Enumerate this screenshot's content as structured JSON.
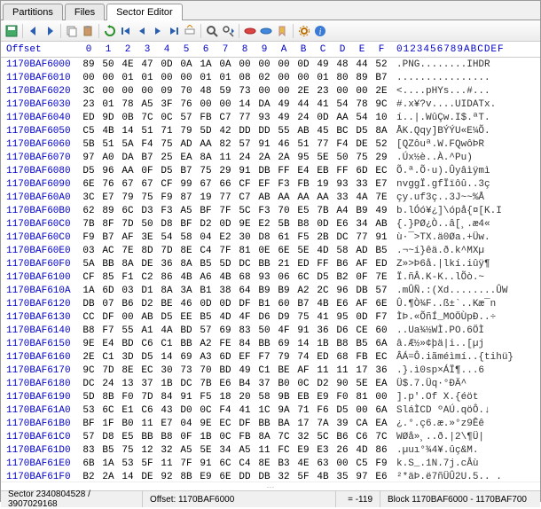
{
  "tabs": {
    "partitions": "Partitions",
    "files": "Files",
    "sector_editor": "Sector Editor"
  },
  "header": {
    "offset_label": "Offset",
    "hex_cols": [
      "0",
      "1",
      "2",
      "3",
      "4",
      "5",
      "6",
      "7",
      "8",
      "9",
      "A",
      "B",
      "C",
      "D",
      "E",
      "F"
    ],
    "ascii_label": "0123456789ABCDEF"
  },
  "rows": [
    {
      "off": "1170BAF6000",
      "hex": [
        "89",
        "50",
        "4E",
        "47",
        "0D",
        "0A",
        "1A",
        "0A",
        "00",
        "00",
        "00",
        "0D",
        "49",
        "48",
        "44",
        "52"
      ],
      "asc": ".PNG........IHDR"
    },
    {
      "off": "1170BAF6010",
      "hex": [
        "00",
        "00",
        "01",
        "01",
        "00",
        "00",
        "01",
        "01",
        "08",
        "02",
        "00",
        "00",
        "01",
        "80",
        "89",
        "B7"
      ],
      "asc": "................"
    },
    {
      "off": "1170BAF6020",
      "hex": [
        "3C",
        "00",
        "00",
        "00",
        "09",
        "70",
        "48",
        "59",
        "73",
        "00",
        "00",
        "2E",
        "23",
        "00",
        "00",
        "2E"
      ],
      "asc": "<....pHYs...#..."
    },
    {
      "off": "1170BAF6030",
      "hex": [
        "23",
        "01",
        "78",
        "A5",
        "3F",
        "76",
        "00",
        "00",
        "14",
        "DA",
        "49",
        "44",
        "41",
        "54",
        "78",
        "9C"
      ],
      "asc": "#.x¥?v....UIDATx."
    },
    {
      "off": "1170BAF6040",
      "hex": [
        "ED",
        "9D",
        "0B",
        "7C",
        "0C",
        "57",
        "FB",
        "C7",
        "77",
        "93",
        "49",
        "24",
        "0D",
        "AA",
        "54",
        "10"
      ],
      "asc": "í..|.WûÇw.I$.ªT."
    },
    {
      "off": "1170BAF6050",
      "hex": [
        "C5",
        "4B",
        "14",
        "51",
        "71",
        "79",
        "5D",
        "42",
        "DD",
        "DD",
        "55",
        "AB",
        "45",
        "BC",
        "D5",
        "8A"
      ],
      "asc": "ÅK.Qqy]BÝÝU«E¼Õ."
    },
    {
      "off": "1170BAF6060",
      "hex": [
        "5B",
        "51",
        "5A",
        "F4",
        "75",
        "AD",
        "AA",
        "82",
        "57",
        "91",
        "46",
        "51",
        "77",
        "F4",
        "DE",
        "52"
      ],
      "asc": "[QZôu­ª.W.FQwôÞR"
    },
    {
      "off": "1170BAF6070",
      "hex": [
        "97",
        "A0",
        "DA",
        "B7",
        "25",
        "EA",
        "8A",
        "11",
        "24",
        "2A",
        "2A",
        "95",
        "5E",
        "50",
        "75",
        "29"
      ],
      "asc": ".Úx½è..À.^Pu)"
    },
    {
      "off": "1170BAF6080",
      "hex": [
        "D5",
        "96",
        "AA",
        "0F",
        "D5",
        "B7",
        "75",
        "29",
        "91",
        "DB",
        "FF",
        "E4",
        "EB",
        "FF",
        "6D",
        "EC"
      ],
      "asc": "Õ.ª.Õ·u).Ûyâìÿmì"
    },
    {
      "off": "1170BAF6090",
      "hex": [
        "6E",
        "76",
        "67",
        "67",
        "CF",
        "99",
        "67",
        "66",
        "CF",
        "EF",
        "F3",
        "FB",
        "19",
        "93",
        "33",
        "E7"
      ],
      "asc": "nvggÏ.gfÏïôû..3ç"
    },
    {
      "off": "1170BAF60A0",
      "hex": [
        "3C",
        "E7",
        "79",
        "75",
        "F9",
        "87",
        "19",
        "77",
        "C7",
        "AB",
        "AA",
        "AA",
        "AA",
        "33",
        "4A",
        "7E"
      ],
      "asc": "çy.uf3ç..3J~~%Å"
    },
    {
      "off": "1170BAF60B0",
      "hex": [
        "62",
        "89",
        "6C",
        "D3",
        "F3",
        "A5",
        "BF",
        "7F",
        "5C",
        "F3",
        "70",
        "E5",
        "7B",
        "A4",
        "B9",
        "49"
      ],
      "asc": "b.lÓó¥¿]\\ópå{¤[K.I"
    },
    {
      "off": "1170BAF60C0",
      "hex": [
        "7B",
        "8F",
        "7D",
        "50",
        "D8",
        "BF",
        "D2",
        "0D",
        "9E",
        "E2",
        "5B",
        "B8",
        "0D",
        "E6",
        "34",
        "AB"
      ],
      "asc": "{.}PØ¿Ò..â[¸.æ4«"
    },
    {
      "off": "1170BAF60C0",
      "hex": [
        "F9",
        "B7",
        "AF",
        "3E",
        "54",
        "58",
        "04",
        "E2",
        "30",
        "D8",
        "61",
        "F5",
        "2B",
        "DC",
        "77",
        "91"
      ],
      "asc": "ù·¯>TX.ä0Øa.+Üw."
    },
    {
      "off": "1170BAF60E0",
      "hex": [
        "03",
        "AC",
        "7E",
        "8D",
        "7D",
        "8E",
        "C4",
        "7F",
        "81",
        "0E",
        "6E",
        "5E",
        "4D",
        "58",
        "AD",
        "B5"
      ],
      "asc": ".¬~í}êä.ð.k^MX­µ"
    },
    {
      "off": "1170BAF60F0",
      "hex": [
        "5A",
        "BB",
        "8A",
        "DE",
        "36",
        "8A",
        "B5",
        "5D",
        "DC",
        "BB",
        "21",
        "ED",
        "FF",
        "B6",
        "AF",
        "ED"
      ],
      "asc": "Z»>Þ6å.|lkí.iûÿ¶"
    },
    {
      "off": "1170BAF6100",
      "hex": [
        "CF",
        "85",
        "F1",
        "C2",
        "86",
        "4B",
        "A6",
        "4B",
        "68",
        "93",
        "06",
        "6C",
        "D5",
        "B2",
        "0F",
        "7E"
      ],
      "asc": "Ï.ñÂ.K-K..lÕò.~"
    },
    {
      "off": "1170BAF610A",
      "hex": [
        "1A",
        "6D",
        "03",
        "D1",
        "8A",
        "3A",
        "B1",
        "38",
        "64",
        "B9",
        "B9",
        "A2",
        "2C",
        "96",
        "DB",
        "57"
      ],
      "asc": ".mÛÑ.:(Xd........ÛW"
    },
    {
      "off": "1170BAF6120",
      "hex": [
        "DB",
        "07",
        "B6",
        "D2",
        "BE",
        "46",
        "0D",
        "0D",
        "DF",
        "B1",
        "60",
        "B7",
        "4B",
        "E6",
        "AF",
        "6E"
      ],
      "asc": "Û.¶Ò¾F..ß±`..Kæ¯n"
    },
    {
      "off": "1170BAF6130",
      "hex": [
        "CC",
        "DF",
        "00",
        "AB",
        "D5",
        "EE",
        "B5",
        "4D",
        "4F",
        "D6",
        "D9",
        "75",
        "41",
        "95",
        "0D",
        "F7"
      ],
      "asc": "ÌÞ.«ÕñÍ_MOÖÙpÐ..÷"
    },
    {
      "off": "1170BAF6140",
      "hex": [
        "B8",
        "F7",
        "55",
        "A1",
        "4A",
        "BD",
        "57",
        "69",
        "83",
        "50",
        "4F",
        "91",
        "36",
        "D6",
        "CE",
        "60"
      ],
      "asc": "..Ua¾½WÌ.PO.6ÖÌ"
    },
    {
      "off": "1170BAF6150",
      "hex": [
        "9E",
        "E4",
        "BD",
        "C6",
        "C1",
        "BB",
        "A2",
        "FE",
        "84",
        "BB",
        "69",
        "14",
        "1B",
        "B8",
        "B5",
        "6A"
      ],
      "asc": "â.Æ½»¢þä|i..[µj"
    },
    {
      "off": "1170BAF6160",
      "hex": [
        "2E",
        "C1",
        "3D",
        "D5",
        "14",
        "69",
        "A3",
        "6D",
        "EF",
        "F7",
        "79",
        "74",
        "ED",
        "68",
        "FB",
        "EC"
      ],
      "asc": "ÂÁ=Ô.iãméìmí..{tihü}"
    },
    {
      "off": "1170BAF6170",
      "hex": [
        "9C",
        "7D",
        "8E",
        "EC",
        "30",
        "73",
        "70",
        "BD",
        "49",
        "C1",
        "BE",
        "AF",
        "11",
        "11",
        "17",
        "36"
      ],
      "asc": ".}.ì0sp×ÁÏ¶...6"
    },
    {
      "off": "1170BAF6180",
      "hex": [
        "DC",
        "24",
        "13",
        "37",
        "1B",
        "DC",
        "7B",
        "E6",
        "B4",
        "37",
        "B0",
        "0C",
        "D2",
        "90",
        "5E",
        "EA"
      ],
      "asc": "Ü$.7.Üq·°ÐÄ^"
    },
    {
      "off": "1170BAF6190",
      "hex": [
        "5D",
        "8B",
        "F0",
        "7D",
        "84",
        "91",
        "F5",
        "18",
        "20",
        "58",
        "9B",
        "EB",
        "E9",
        "F0",
        "81",
        "00"
      ],
      "asc": "].p'.Of X.{éöt"
    },
    {
      "off": "1170BAF61A0",
      "hex": [
        "53",
        "6C",
        "E1",
        "C6",
        "43",
        "D0",
        "0C",
        "F4",
        "41",
        "1C",
        "9A",
        "71",
        "F6",
        "D5",
        "00",
        "6A"
      ],
      "asc": "SláÌCD ºAÚ.qöÔ.↓"
    },
    {
      "off": "1170BAF61B0",
      "hex": [
        "BF",
        "1F",
        "B0",
        "11",
        "E7",
        "04",
        "9E",
        "EC",
        "DF",
        "BB",
        "BA",
        "17",
        "7A",
        "39",
        "CA",
        "EA"
      ],
      "asc": "¿.°.ç6.æ.»°z9Êê"
    },
    {
      "off": "1170BAF61C0",
      "hex": [
        "57",
        "D8",
        "E5",
        "BB",
        "B8",
        "0F",
        "1B",
        "0C",
        "FB",
        "8A",
        "7C",
        "32",
        "5C",
        "B6",
        "C6",
        "7C"
      ],
      "asc": "WØå»¸..ð.|2\\¶Ü|"
    },
    {
      "off": "1170BAF61D0",
      "hex": [
        "83",
        "B5",
        "75",
        "12",
        "32",
        "A5",
        "5E",
        "34",
        "A5",
        "11",
        "FC",
        "E9",
        "E3",
        "26",
        "4D",
        "86"
      ],
      "asc": ".µuı°¾4¥.ûç&M."
    },
    {
      "off": "1170BAF61E0",
      "hex": [
        "6B",
        "1A",
        "53",
        "5F",
        "11",
        "7F",
        "91",
        "6C",
        "C4",
        "8E",
        "B3",
        "4E",
        "63",
        "00",
        "C5",
        "F9"
      ],
      "asc": "k.S_.1N.7j.cÂù"
    },
    {
      "off": "1170BAF61F0",
      "hex": [
        "B2",
        "2A",
        "14",
        "DE",
        "92",
        "8B",
        "E9",
        "6E",
        "DD",
        "DB",
        "32",
        "5F",
        "4B",
        "35",
        "97",
        "E6"
      ],
      "asc": "²*äÞ.ë7ñÜÛ2U.5.. ."
    }
  ],
  "status": {
    "sector": "Sector 2340804528 / 3907029168",
    "offset": "Offset: 1170BAF6000",
    "value": "= -119",
    "block": "Block 1170BAF6000 - 1170BAF700"
  }
}
